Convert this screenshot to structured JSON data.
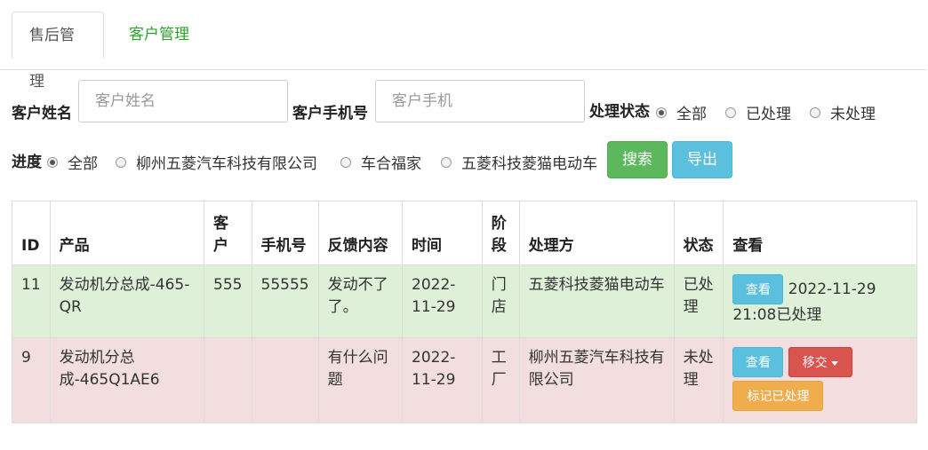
{
  "tabs": [
    {
      "label": "售后管理"
    },
    {
      "label": "客户管理"
    }
  ],
  "filters": {
    "customer_name_label": "客户姓名",
    "customer_name_placeholder": "客户姓名",
    "customer_phone_label": "客户手机号",
    "customer_phone_placeholder": "客户手机",
    "status_label": "处理状态",
    "status_options": [
      "全部",
      "已处理",
      "未处理"
    ],
    "status_selected": "全部",
    "progress_label": "进度",
    "progress_options": [
      "全部",
      "柳州五菱汽车科技有限公司",
      "车合福家",
      "五菱科技菱猫电动车"
    ],
    "progress_selected": "全部",
    "search_button": "搜索",
    "export_button": "导出"
  },
  "table": {
    "headers": [
      "ID",
      "产品",
      "客户",
      "手机号",
      "反馈内容",
      "时间",
      "阶段",
      "处理方",
      "状态",
      "查看"
    ],
    "rows": [
      {
        "id": "11",
        "product": "发动机分总成-465-QR",
        "customer": "555",
        "phone": "55555",
        "feedback": "发动不了了。",
        "time": "2022-11-29",
        "stage": "门店",
        "handler": "五菱科技菱猫电动车",
        "status": "已处理",
        "view_button": "查看",
        "view_note": "2022-11-29 21:08已处理"
      },
      {
        "id": "9",
        "product": "发动机分总成-465Q1AE6",
        "customer": "",
        "phone": "",
        "feedback": "有什么问题",
        "time": "2022-11-29",
        "stage": "工厂",
        "handler": "柳州五菱汽车科技有限公司",
        "status": "未处理",
        "view_button": "查看",
        "transfer_button": "移交",
        "mark_button": "标记已处理"
      }
    ]
  },
  "colors": {
    "tab_link": "#2aa52a",
    "success_row": "#dff0d8",
    "danger_row": "#f2dede",
    "btn_search": "#5cb85c",
    "btn_info": "#5bc0de",
    "btn_danger": "#d9534f",
    "btn_warning": "#f0ad4e"
  }
}
